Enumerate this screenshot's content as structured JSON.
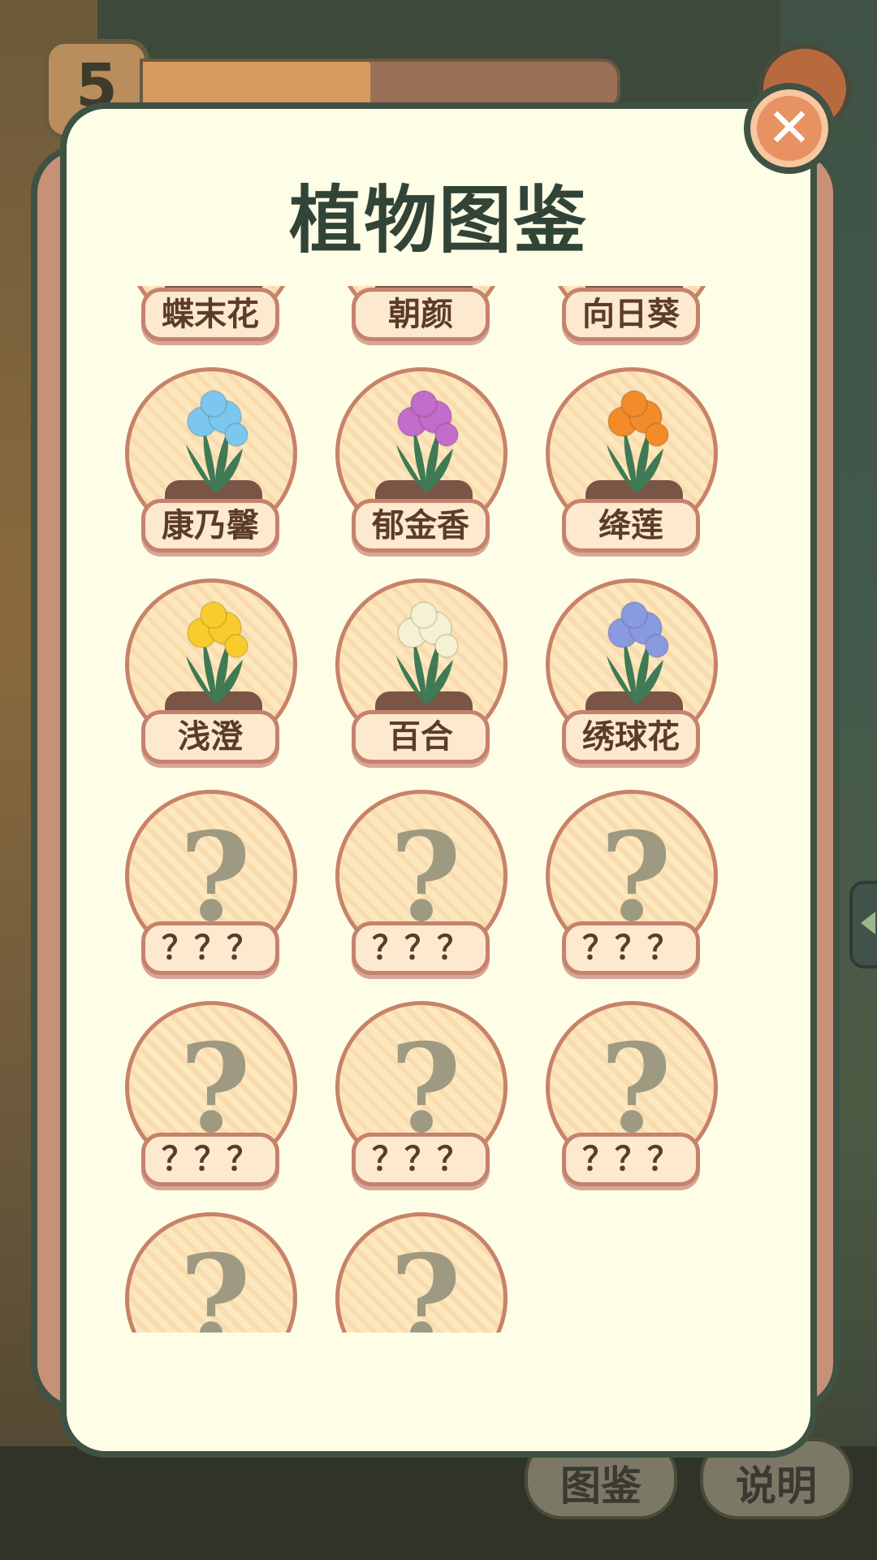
{
  "header": {
    "level": "5",
    "progress": 0.48
  },
  "modal": {
    "title": "植物图鉴",
    "close_label": "✕"
  },
  "bottom": {
    "guide_label": "图鉴",
    "help_label": "说明"
  },
  "plants": [
    {
      "name": "蝶末花",
      "unlocked": true,
      "flower_color": "#f2cf6a"
    },
    {
      "name": "朝颜",
      "unlocked": true,
      "flower_color": "#c07ad0"
    },
    {
      "name": "向日葵",
      "unlocked": true,
      "flower_color": "#f5b82e"
    },
    {
      "name": "康乃馨",
      "unlocked": true,
      "flower_color": "#7cc7ef"
    },
    {
      "name": "郁金香",
      "unlocked": true,
      "flower_color": "#c36cc9"
    },
    {
      "name": "绛莲",
      "unlocked": true,
      "flower_color": "#f28b2a"
    },
    {
      "name": "浅澄",
      "unlocked": true,
      "flower_color": "#f8cc2c"
    },
    {
      "name": "百合",
      "unlocked": true,
      "flower_color": "#f4f2d2"
    },
    {
      "name": "绣球花",
      "unlocked": true,
      "flower_color": "#8a9ae0"
    },
    {
      "name": "？？？",
      "unlocked": false
    },
    {
      "name": "？？？",
      "unlocked": false
    },
    {
      "name": "？？？",
      "unlocked": false
    },
    {
      "name": "？？？",
      "unlocked": false
    },
    {
      "name": "？？？",
      "unlocked": false
    },
    {
      "name": "？？？",
      "unlocked": false
    },
    {
      "name": "？？？",
      "unlocked": false
    },
    {
      "name": "？？？",
      "unlocked": false
    }
  ],
  "locked_symbol": "?",
  "icons": {
    "close": "close-icon",
    "arrow": "arrow-left-icon",
    "flower": "flower-icon",
    "unknown": "question-mark-icon"
  }
}
